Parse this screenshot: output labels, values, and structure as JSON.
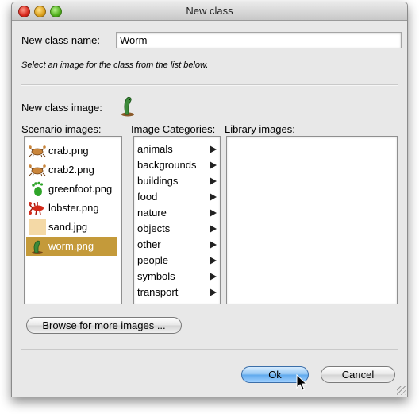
{
  "window": {
    "title": "New class"
  },
  "form": {
    "name_label": "New class name:",
    "name_value": "Worm",
    "hint": "Select an image for the class from the list below.",
    "image_label": "New class image:"
  },
  "scenario": {
    "header": "Scenario images:",
    "items": [
      {
        "label": "crab.png",
        "icon": "crab-icon"
      },
      {
        "label": "crab2.png",
        "icon": "crab-icon"
      },
      {
        "label": "greenfoot.png",
        "icon": "greenfoot-icon"
      },
      {
        "label": "lobster.png",
        "icon": "lobster-icon"
      },
      {
        "label": "sand.jpg",
        "icon": "sand-icon"
      },
      {
        "label": "worm.png",
        "icon": "worm-icon",
        "selected": true
      }
    ]
  },
  "categories": {
    "header": "Image Categories:",
    "items": [
      {
        "label": "animals"
      },
      {
        "label": "backgrounds"
      },
      {
        "label": "buildings"
      },
      {
        "label": "food"
      },
      {
        "label": "nature"
      },
      {
        "label": "objects"
      },
      {
        "label": "other"
      },
      {
        "label": "people"
      },
      {
        "label": "symbols"
      },
      {
        "label": "transport"
      }
    ]
  },
  "library": {
    "header": "Library images:"
  },
  "buttons": {
    "browse": "Browse for more images ...",
    "ok": "Ok",
    "cancel": "Cancel"
  },
  "colors": {
    "selection": "#c49a3a",
    "default_button": "#5ea8ec"
  }
}
